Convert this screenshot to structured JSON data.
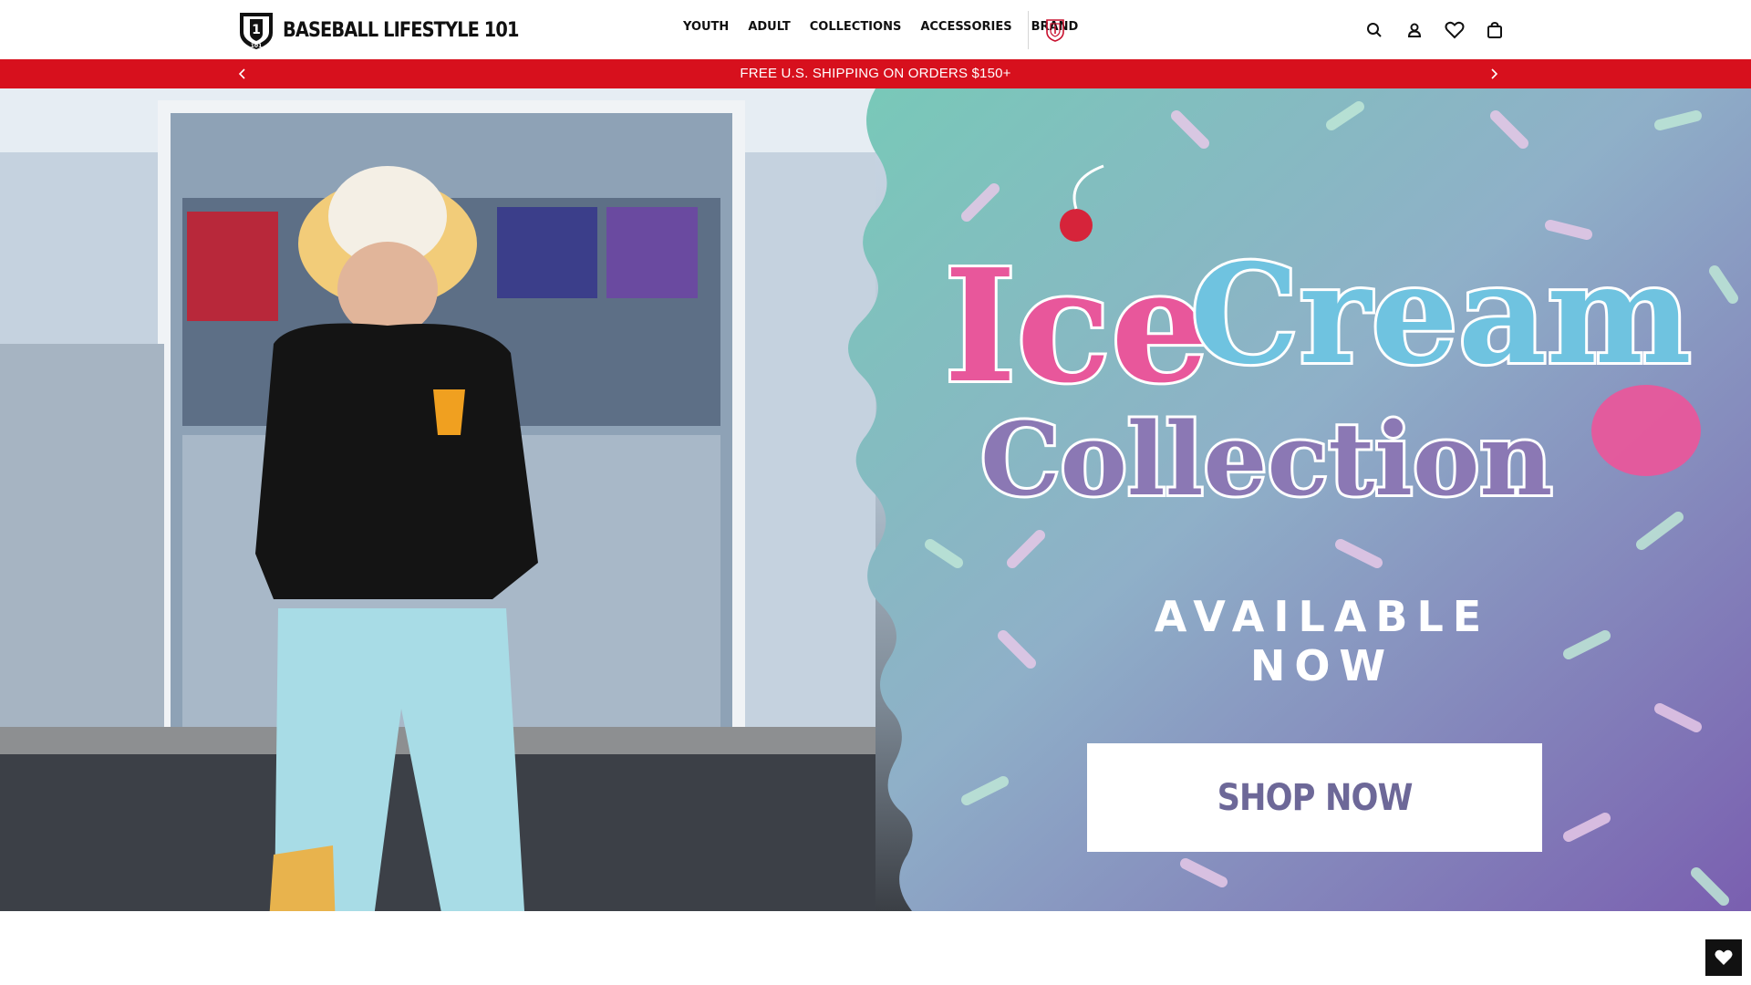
{
  "header": {
    "brand_name": "BASEBALL LIFESTYLE 101",
    "logo_mark_text": "101",
    "nav": [
      "YOUTH",
      "ADULT",
      "COLLECTIONS",
      "ACCESSORIES",
      "BRAND"
    ],
    "icons": [
      "search-icon",
      "account-icon",
      "heart-icon",
      "cart-icon"
    ]
  },
  "promo": {
    "text": "FREE U.S. SHIPPING ON ORDERS $150+",
    "background": "#d7101d"
  },
  "hero": {
    "title_line1_a": "Ice",
    "title_line1_b": "Cream",
    "title_line2": "Collection",
    "subtitle": "AVAILABLE NOW",
    "cta": "SHOP NOW",
    "colors": {
      "ice": "#e8579b",
      "cream": "#6fc3e0",
      "collection": "#8b78b4",
      "cta_text": "#6d6898"
    }
  },
  "wishlist_float": {
    "icon": "heart-icon"
  }
}
